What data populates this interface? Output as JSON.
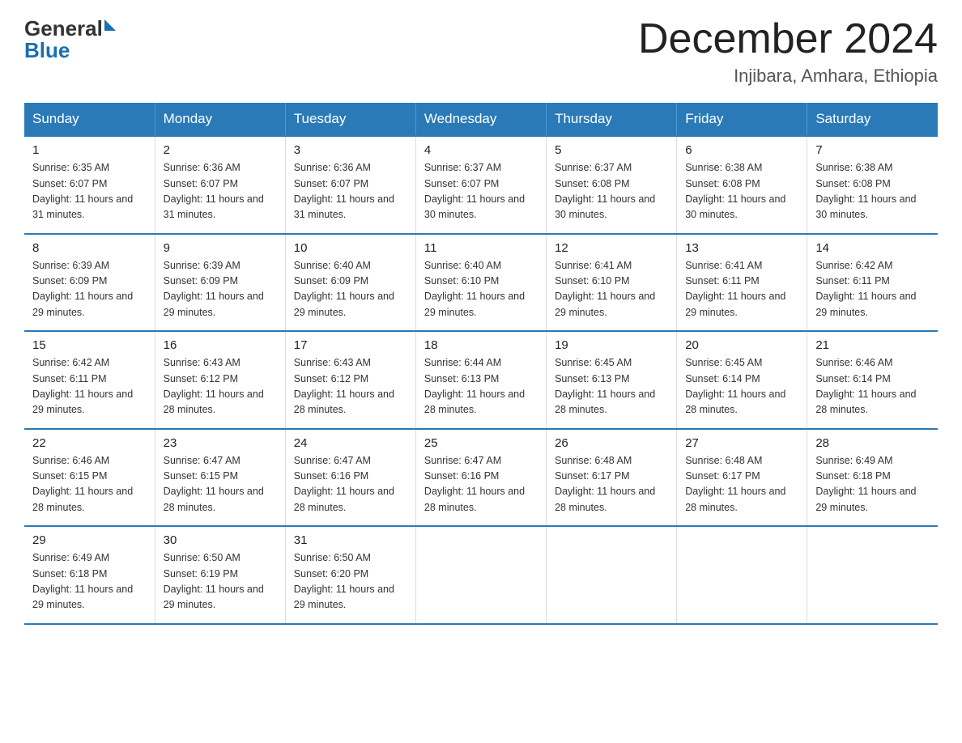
{
  "header": {
    "logo_general": "General",
    "logo_blue": "Blue",
    "month_title": "December 2024",
    "location": "Injibara, Amhara, Ethiopia"
  },
  "days_of_week": [
    "Sunday",
    "Monday",
    "Tuesday",
    "Wednesday",
    "Thursday",
    "Friday",
    "Saturday"
  ],
  "weeks": [
    [
      {
        "day": "1",
        "sunrise": "6:35 AM",
        "sunset": "6:07 PM",
        "daylight": "11 hours and 31 minutes."
      },
      {
        "day": "2",
        "sunrise": "6:36 AM",
        "sunset": "6:07 PM",
        "daylight": "11 hours and 31 minutes."
      },
      {
        "day": "3",
        "sunrise": "6:36 AM",
        "sunset": "6:07 PM",
        "daylight": "11 hours and 31 minutes."
      },
      {
        "day": "4",
        "sunrise": "6:37 AM",
        "sunset": "6:07 PM",
        "daylight": "11 hours and 30 minutes."
      },
      {
        "day": "5",
        "sunrise": "6:37 AM",
        "sunset": "6:08 PM",
        "daylight": "11 hours and 30 minutes."
      },
      {
        "day": "6",
        "sunrise": "6:38 AM",
        "sunset": "6:08 PM",
        "daylight": "11 hours and 30 minutes."
      },
      {
        "day": "7",
        "sunrise": "6:38 AM",
        "sunset": "6:08 PM",
        "daylight": "11 hours and 30 minutes."
      }
    ],
    [
      {
        "day": "8",
        "sunrise": "6:39 AM",
        "sunset": "6:09 PM",
        "daylight": "11 hours and 29 minutes."
      },
      {
        "day": "9",
        "sunrise": "6:39 AM",
        "sunset": "6:09 PM",
        "daylight": "11 hours and 29 minutes."
      },
      {
        "day": "10",
        "sunrise": "6:40 AM",
        "sunset": "6:09 PM",
        "daylight": "11 hours and 29 minutes."
      },
      {
        "day": "11",
        "sunrise": "6:40 AM",
        "sunset": "6:10 PM",
        "daylight": "11 hours and 29 minutes."
      },
      {
        "day": "12",
        "sunrise": "6:41 AM",
        "sunset": "6:10 PM",
        "daylight": "11 hours and 29 minutes."
      },
      {
        "day": "13",
        "sunrise": "6:41 AM",
        "sunset": "6:11 PM",
        "daylight": "11 hours and 29 minutes."
      },
      {
        "day": "14",
        "sunrise": "6:42 AM",
        "sunset": "6:11 PM",
        "daylight": "11 hours and 29 minutes."
      }
    ],
    [
      {
        "day": "15",
        "sunrise": "6:42 AM",
        "sunset": "6:11 PM",
        "daylight": "11 hours and 29 minutes."
      },
      {
        "day": "16",
        "sunrise": "6:43 AM",
        "sunset": "6:12 PM",
        "daylight": "11 hours and 28 minutes."
      },
      {
        "day": "17",
        "sunrise": "6:43 AM",
        "sunset": "6:12 PM",
        "daylight": "11 hours and 28 minutes."
      },
      {
        "day": "18",
        "sunrise": "6:44 AM",
        "sunset": "6:13 PM",
        "daylight": "11 hours and 28 minutes."
      },
      {
        "day": "19",
        "sunrise": "6:45 AM",
        "sunset": "6:13 PM",
        "daylight": "11 hours and 28 minutes."
      },
      {
        "day": "20",
        "sunrise": "6:45 AM",
        "sunset": "6:14 PM",
        "daylight": "11 hours and 28 minutes."
      },
      {
        "day": "21",
        "sunrise": "6:46 AM",
        "sunset": "6:14 PM",
        "daylight": "11 hours and 28 minutes."
      }
    ],
    [
      {
        "day": "22",
        "sunrise": "6:46 AM",
        "sunset": "6:15 PM",
        "daylight": "11 hours and 28 minutes."
      },
      {
        "day": "23",
        "sunrise": "6:47 AM",
        "sunset": "6:15 PM",
        "daylight": "11 hours and 28 minutes."
      },
      {
        "day": "24",
        "sunrise": "6:47 AM",
        "sunset": "6:16 PM",
        "daylight": "11 hours and 28 minutes."
      },
      {
        "day": "25",
        "sunrise": "6:47 AM",
        "sunset": "6:16 PM",
        "daylight": "11 hours and 28 minutes."
      },
      {
        "day": "26",
        "sunrise": "6:48 AM",
        "sunset": "6:17 PM",
        "daylight": "11 hours and 28 minutes."
      },
      {
        "day": "27",
        "sunrise": "6:48 AM",
        "sunset": "6:17 PM",
        "daylight": "11 hours and 28 minutes."
      },
      {
        "day": "28",
        "sunrise": "6:49 AM",
        "sunset": "6:18 PM",
        "daylight": "11 hours and 29 minutes."
      }
    ],
    [
      {
        "day": "29",
        "sunrise": "6:49 AM",
        "sunset": "6:18 PM",
        "daylight": "11 hours and 29 minutes."
      },
      {
        "day": "30",
        "sunrise": "6:50 AM",
        "sunset": "6:19 PM",
        "daylight": "11 hours and 29 minutes."
      },
      {
        "day": "31",
        "sunrise": "6:50 AM",
        "sunset": "6:20 PM",
        "daylight": "11 hours and 29 minutes."
      },
      null,
      null,
      null,
      null
    ]
  ]
}
